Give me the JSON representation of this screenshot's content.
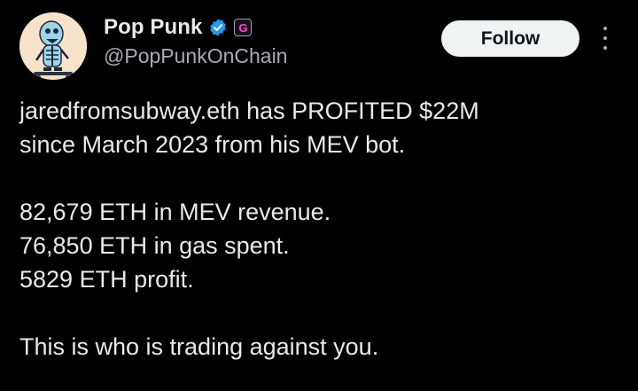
{
  "author": {
    "display_name": "Pop Punk",
    "handle": "@PopPunkOnChain",
    "avatar_icon": "skeleton-penguin-avatar",
    "verified_color": "#1d9bf0",
    "affiliate_badge_letter": "G"
  },
  "follow_button": {
    "label": "Follow"
  },
  "more_button": {
    "icon": "more-vertical-icon"
  },
  "tweet": {
    "line1": "jaredfromsubway.eth has PROFITED $22M",
    "line2": "since March 2023 from his MEV bot.",
    "line3": "82,679 ETH in MEV revenue.",
    "line4": "76,850 ETH in gas spent.",
    "line5": "5829 ETH profit.",
    "line6": "This is who is trading against you."
  },
  "colors": {
    "background": "#000000",
    "text": "#e7e9ea",
    "secondary_text": "#a4adb5",
    "follow_bg": "#eff3f4"
  }
}
